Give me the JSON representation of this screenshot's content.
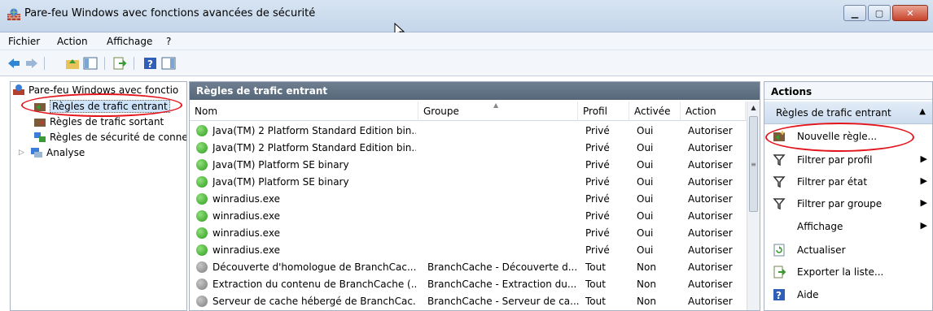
{
  "window": {
    "title": "Pare-feu Windows avec fonctions avancées de sécurité"
  },
  "menu": [
    "Fichier",
    "Action",
    "Affichage",
    "?"
  ],
  "tree": {
    "root": "Pare-feu Windows avec fonctio",
    "items": [
      {
        "label": "Règles de trafic entrant",
        "selected": true
      },
      {
        "label": "Règles de trafic sortant",
        "selected": false
      },
      {
        "label": "Règles de sécurité de conne",
        "selected": false
      },
      {
        "label": "Analyse",
        "selected": false
      }
    ]
  },
  "center": {
    "title": "Règles de trafic entrant",
    "columns": [
      "Nom",
      "Groupe",
      "Profil",
      "Activée",
      "Action"
    ],
    "rows": [
      {
        "nom": "Java(TM) 2 Platform Standard Edition bin...",
        "groupe": "",
        "profil": "Privé",
        "activee": "Oui",
        "action": "Autoriser",
        "status": "green"
      },
      {
        "nom": "Java(TM) 2 Platform Standard Edition bin...",
        "groupe": "",
        "profil": "Privé",
        "activee": "Oui",
        "action": "Autoriser",
        "status": "green"
      },
      {
        "nom": "Java(TM) Platform SE binary",
        "groupe": "",
        "profil": "Privé",
        "activee": "Oui",
        "action": "Autoriser",
        "status": "green"
      },
      {
        "nom": "Java(TM) Platform SE binary",
        "groupe": "",
        "profil": "Privé",
        "activee": "Oui",
        "action": "Autoriser",
        "status": "green"
      },
      {
        "nom": "winradius.exe",
        "groupe": "",
        "profil": "Privé",
        "activee": "Oui",
        "action": "Autoriser",
        "status": "green"
      },
      {
        "nom": "winradius.exe",
        "groupe": "",
        "profil": "Privé",
        "activee": "Oui",
        "action": "Autoriser",
        "status": "green"
      },
      {
        "nom": "winradius.exe",
        "groupe": "",
        "profil": "Privé",
        "activee": "Oui",
        "action": "Autoriser",
        "status": "green"
      },
      {
        "nom": "winradius.exe",
        "groupe": "",
        "profil": "Privé",
        "activee": "Oui",
        "action": "Autoriser",
        "status": "green"
      },
      {
        "nom": "Découverte d'homologue de BranchCac...",
        "groupe": "BranchCache - Découverte d...",
        "profil": "Tout",
        "activee": "Non",
        "action": "Autoriser",
        "status": "gray"
      },
      {
        "nom": "Extraction du contenu de BranchCache (...",
        "groupe": "BranchCache - Extraction du...",
        "profil": "Tout",
        "activee": "Non",
        "action": "Autoriser",
        "status": "gray"
      },
      {
        "nom": "Serveur de cache hébergé de BranchCac...",
        "groupe": "BranchCache - Serveur de ca...",
        "profil": "Tout",
        "activee": "Non",
        "action": "Autoriser",
        "status": "gray"
      }
    ]
  },
  "actions": {
    "title": "Actions",
    "section": "Règles de trafic entrant",
    "items": [
      {
        "label": "Nouvelle règle...",
        "icon": "new-rule-icon",
        "submenu": false
      },
      {
        "label": "Filtrer par profil",
        "icon": "filter-icon",
        "submenu": true
      },
      {
        "label": "Filtrer par état",
        "icon": "filter-icon",
        "submenu": true
      },
      {
        "label": "Filtrer par groupe",
        "icon": "filter-icon",
        "submenu": true
      },
      {
        "label": "Affichage",
        "icon": "",
        "submenu": true
      },
      {
        "label": "Actualiser",
        "icon": "refresh-icon",
        "submenu": false
      },
      {
        "label": "Exporter la liste...",
        "icon": "export-icon",
        "submenu": false
      },
      {
        "label": "Aide",
        "icon": "help-icon",
        "submenu": false
      }
    ]
  },
  "colors": {
    "highlight_ring": "#e3151c",
    "header_bar": "#56677a",
    "enabled_icon": "#2e9b1d",
    "disabled_icon": "#7d7d7d"
  }
}
